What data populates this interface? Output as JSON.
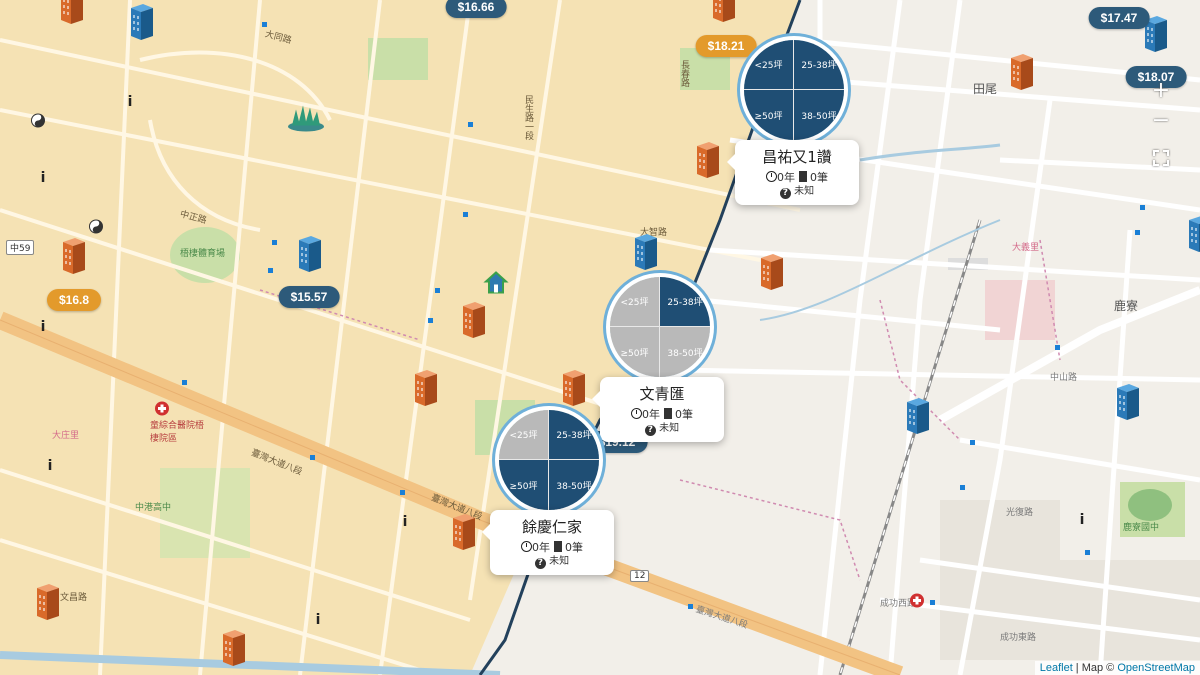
{
  "price_tags": [
    {
      "id": "p1",
      "text": "$16.66",
      "color": "blue"
    },
    {
      "id": "p2",
      "text": "$18.21",
      "color": "orange"
    },
    {
      "id": "p3",
      "text": "$17.47",
      "color": "blue"
    },
    {
      "id": "p4",
      "text": "$18.07",
      "color": "blue"
    },
    {
      "id": "p5",
      "text": "$16.8",
      "color": "orange"
    },
    {
      "id": "p6",
      "text": "$15.57",
      "color": "blue"
    },
    {
      "id": "p7",
      "text": "$19.12",
      "color": "blue"
    }
  ],
  "clusters": [
    {
      "id": "c1",
      "q": [
        "<25坪",
        "25-38坪",
        "≥50坪",
        "38-50坪"
      ],
      "shade": [
        "dark",
        "dark",
        "dark",
        "dark"
      ],
      "popup": {
        "name": "昌祐又1讚",
        "years": "0年",
        "count": "0筆",
        "status": "未知"
      }
    },
    {
      "id": "c2",
      "q": [
        "<25坪",
        "25-38坪",
        "≥50坪",
        "38-50坪"
      ],
      "shade": [
        "gray",
        "dark",
        "gray",
        "gray"
      ],
      "popup": {
        "name": "文青匯",
        "years": "0年",
        "count": "0筆",
        "status": "未知"
      }
    },
    {
      "id": "c3",
      "q": [
        "<25坪",
        "25-38坪",
        "≥50坪",
        "38-50坪"
      ],
      "shade": [
        "gray",
        "dark",
        "dark",
        "dark"
      ],
      "popup": {
        "name": "餘慶仁家",
        "years": "0年",
        "count": "0筆",
        "status": "未知"
      }
    }
  ],
  "controls": {
    "zoom_in": "+",
    "zoom_out": "−"
  },
  "attribution": {
    "leaflet": "Leaflet",
    "sep": " | Map © ",
    "osm": "OpenStreetMap"
  },
  "map_labels": {
    "taiwan_blvd_8": "臺灣大道八段",
    "taiwan_blvd_8b": "臺灣大道八段",
    "taiwan_blvd_8c": "臺灣大道八段",
    "zhongshan_rd": "中山路",
    "wenchang_rd": "文昌路",
    "dazhi_rd": "大智路",
    "minsheng_rd1": "民生路一段",
    "datong_rd": "大同路",
    "lugang": "鹿寮",
    "tianwei": "田尾",
    "zhongzheng_rd": "中正路",
    "changan": "長春路",
    "guangfu": "光復路",
    "chenggong_w": "成功西路",
    "chenggong_e": "成功東路",
    "hospital": "童綜合醫院梧棲院區",
    "sports": "梧棲體育場",
    "wuqi_mid": "中港高中",
    "ludon_mid": "鹿寮國中",
    "road12": "12",
    "road59": "中59",
    "dayi": "大義里",
    "datong": "大庄里"
  }
}
